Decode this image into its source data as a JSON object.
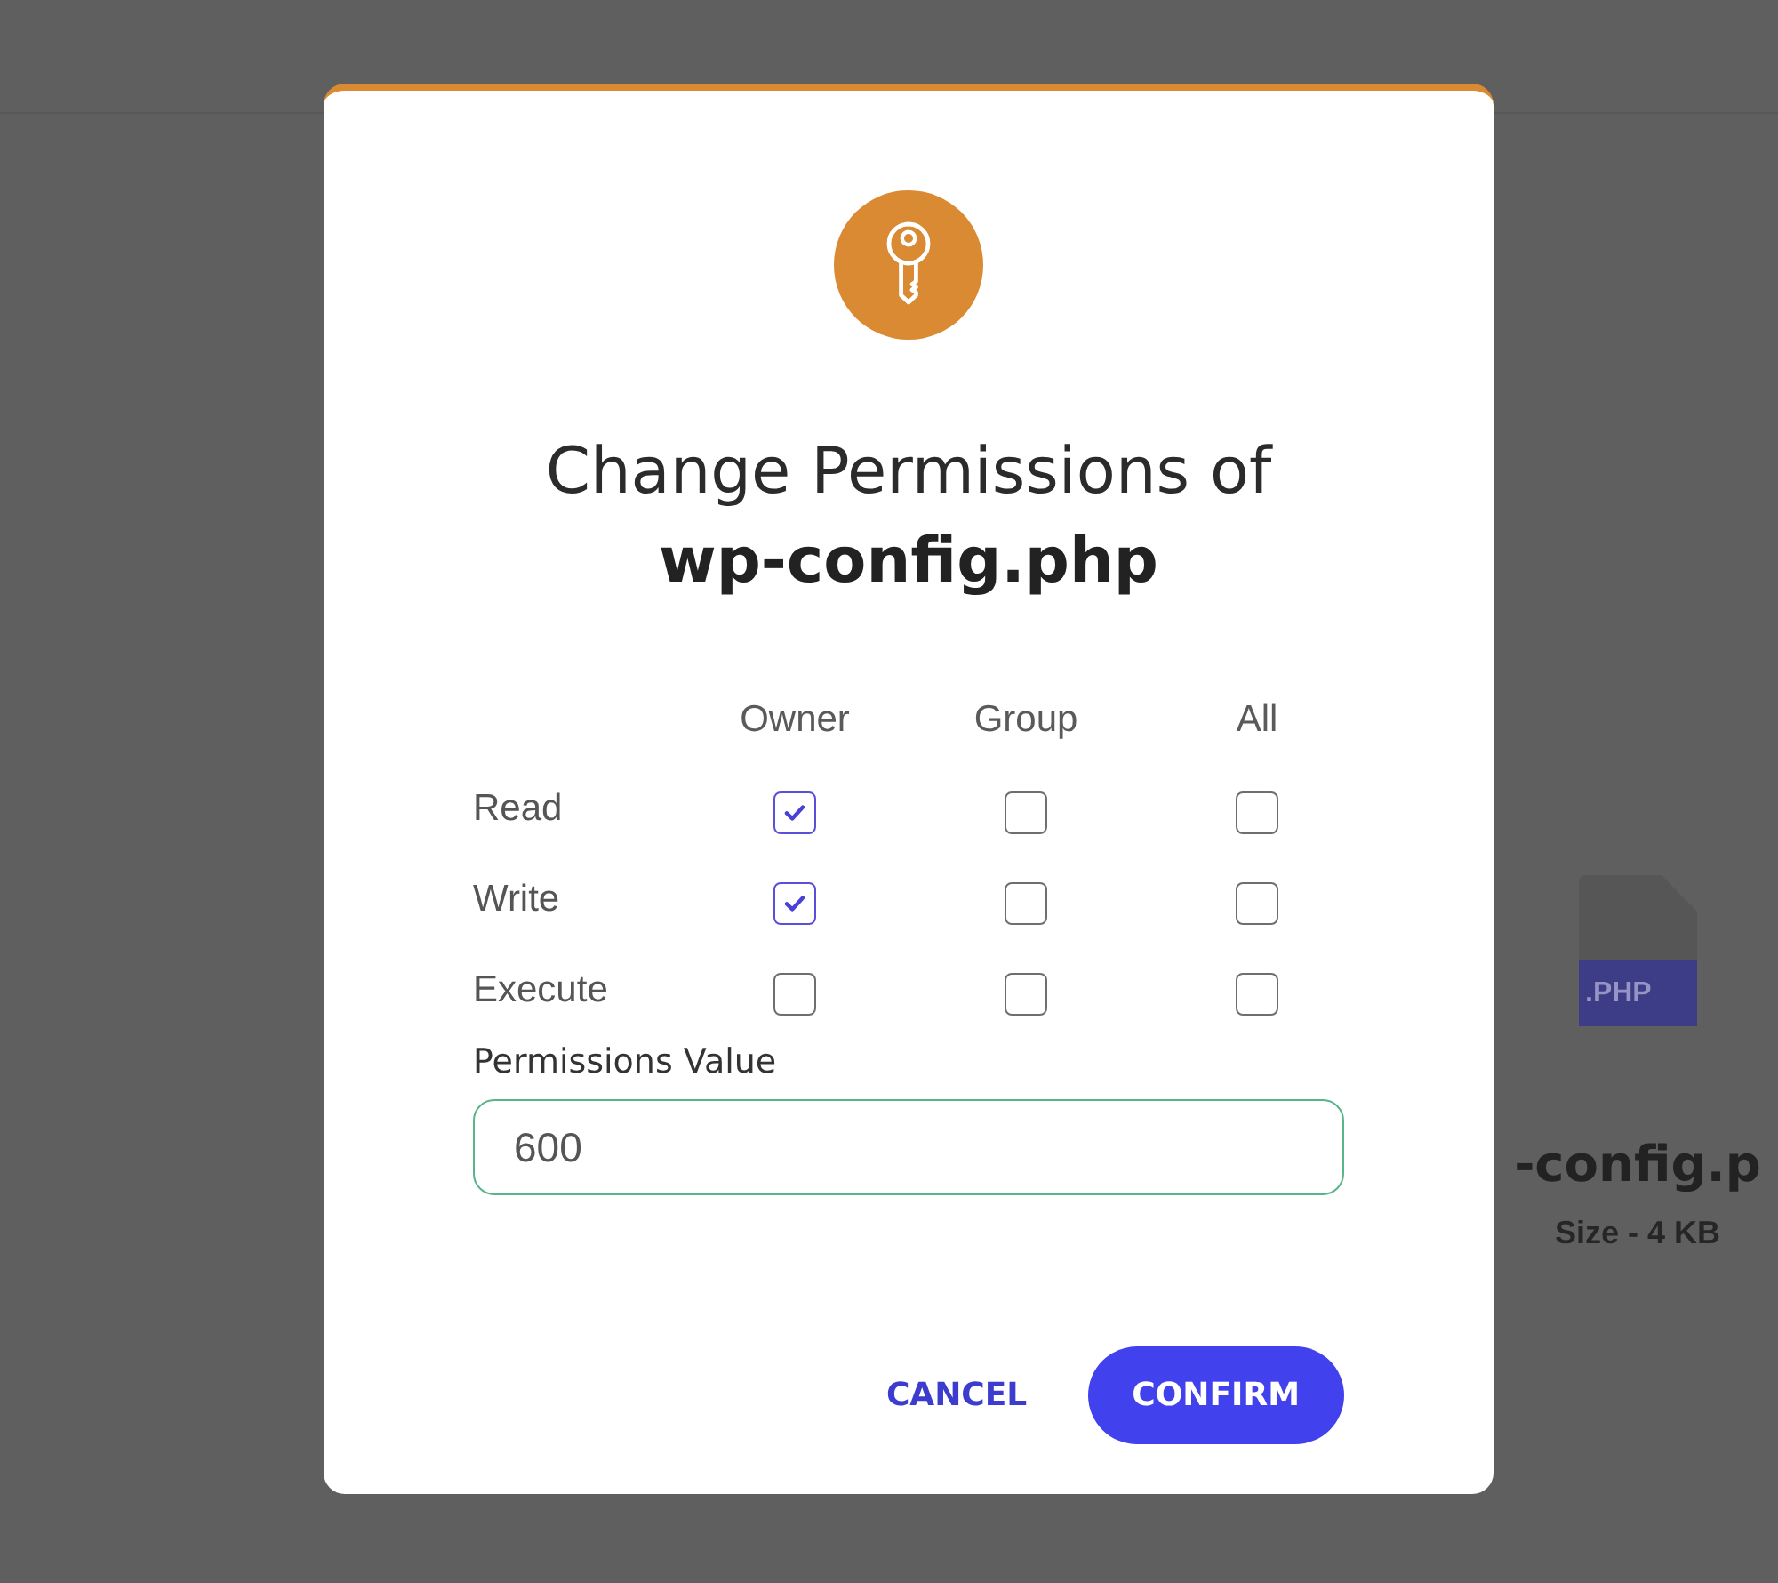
{
  "background": {
    "file_card": {
      "extension": ".PHP",
      "name": "-config.p",
      "size": "Size - 4 KB"
    }
  },
  "dialog": {
    "title": "Change Permissions of",
    "filename": "wp-config.php",
    "permissions": {
      "columns": [
        "Owner",
        "Group",
        "All"
      ],
      "rows": [
        {
          "label": "Read",
          "cells": [
            {
              "checked": true
            },
            {
              "checked": false
            },
            {
              "checked": false
            }
          ]
        },
        {
          "label": "Write",
          "cells": [
            {
              "checked": true
            },
            {
              "checked": false
            },
            {
              "checked": false
            }
          ]
        },
        {
          "label": "Execute",
          "cells": [
            {
              "checked": false
            },
            {
              "checked": false
            },
            {
              "checked": false
            }
          ]
        }
      ]
    },
    "value_field": {
      "label": "Permissions Value",
      "value": "600"
    },
    "buttons": [
      {
        "label": "CANCEL",
        "kind": "text"
      },
      {
        "label": "CONFIRM",
        "kind": "filled"
      }
    ]
  }
}
